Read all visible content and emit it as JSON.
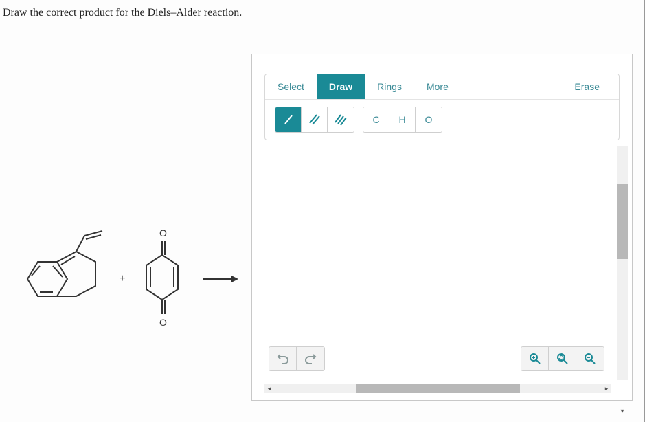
{
  "question": "Draw the correct product for the Diels–Alder reaction.",
  "reaction": {
    "plus": "+",
    "arrow": "→"
  },
  "toolbar": {
    "tabs": {
      "select": "Select",
      "draw": "Draw",
      "rings": "Rings",
      "more": "More",
      "erase": "Erase"
    },
    "bonds": {
      "single": "/",
      "double": "//",
      "triple": "///"
    },
    "atoms": {
      "carbon": "C",
      "hydrogen": "H",
      "oxygen": "O"
    }
  },
  "controls": {
    "undo": "↶",
    "redo": "↷",
    "zoom_in": "⊕",
    "zoom_reset": "↻",
    "zoom_out": "⊖"
  }
}
